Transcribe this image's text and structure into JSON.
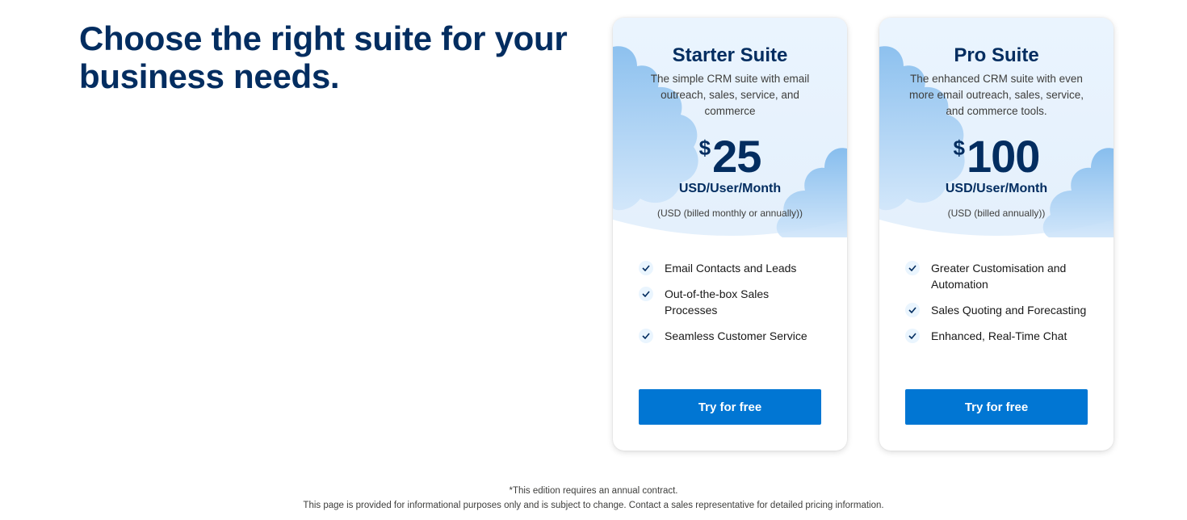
{
  "headline": "Choose the right suite for your business needs.",
  "colors": {
    "brand_navy": "#032d60",
    "button_blue": "#0176d3",
    "hero_bg": "#eaf5fe",
    "cloud_blue": "#8ec5f2"
  },
  "plans": [
    {
      "title": "Starter Suite",
      "description": "The simple CRM suite with email outreach, sales, service, and commerce",
      "currency": "$",
      "price": "25",
      "unit": "USD/User/Month",
      "billing": "(USD (billed monthly or annually))",
      "features": [
        "Email Contacts and Leads",
        "Out-of-the-box Sales Processes",
        "Seamless Customer Service"
      ],
      "cta": "Try for free"
    },
    {
      "title": "Pro Suite",
      "description": "The enhanced CRM suite with even more email outreach, sales, service, and commerce tools.",
      "currency": "$",
      "price": "100",
      "unit": "USD/User/Month",
      "billing": "(USD (billed annually))",
      "features": [
        "Greater Customisation and Automation",
        "Sales Quoting and Forecasting",
        "Enhanced, Real-Time Chat"
      ],
      "cta": "Try for free"
    }
  ],
  "footnote": {
    "line1": "*This edition requires an annual contract.",
    "line2": "This page is provided for informational purposes only and is subject to change. Contact a sales representative for detailed pricing information."
  },
  "icons": {
    "check": "check-icon",
    "cloud": "cloud-illustration"
  }
}
